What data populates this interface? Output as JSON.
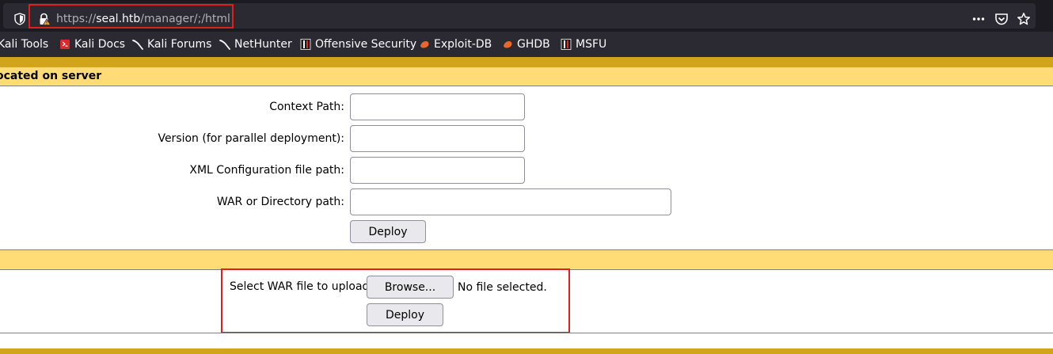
{
  "browser": {
    "url": {
      "scheme": "https://",
      "host": "seal.htb",
      "path": "/manager/;/html"
    },
    "toolbar_icons": [
      "more-options-icon",
      "pocket-icon",
      "bookmark-star-icon"
    ],
    "bookmarks": [
      {
        "label": "Kali Tools",
        "icon": ""
      },
      {
        "label": "Kali Docs",
        "icon": "kali-docs-icon"
      },
      {
        "label": "Kali Forums",
        "icon": "kali-dragon-icon"
      },
      {
        "label": "NetHunter",
        "icon": "kali-dragon-icon"
      },
      {
        "label": "Offensive Security",
        "icon": "offsec-icon"
      },
      {
        "label": "Exploit-DB",
        "icon": "exploit-db-icon"
      },
      {
        "label": "GHDB",
        "icon": "exploit-db-icon"
      },
      {
        "label": "MSFU",
        "icon": "offsec-icon"
      }
    ],
    "colors": {
      "highlight": "#e02020",
      "chrome_dark": "#1c1b22",
      "chrome": "#2b2a33"
    }
  },
  "deploy_server": {
    "header": "ocated on server",
    "fields": [
      {
        "label": "Context Path:",
        "value": ""
      },
      {
        "label": "Version (for parallel deployment):",
        "value": ""
      },
      {
        "label": "XML Configuration file path:",
        "value": ""
      },
      {
        "label": "WAR or Directory path:",
        "value": ""
      }
    ],
    "deploy_button": "Deploy"
  },
  "deploy_upload": {
    "select_label": "Select WAR file to upload",
    "browse_button": "Browse...",
    "file_status": "No file selected.",
    "deploy_button": "Deploy"
  },
  "theme": {
    "gold": "#d2a41c",
    "header_band": "#ffdc75"
  }
}
